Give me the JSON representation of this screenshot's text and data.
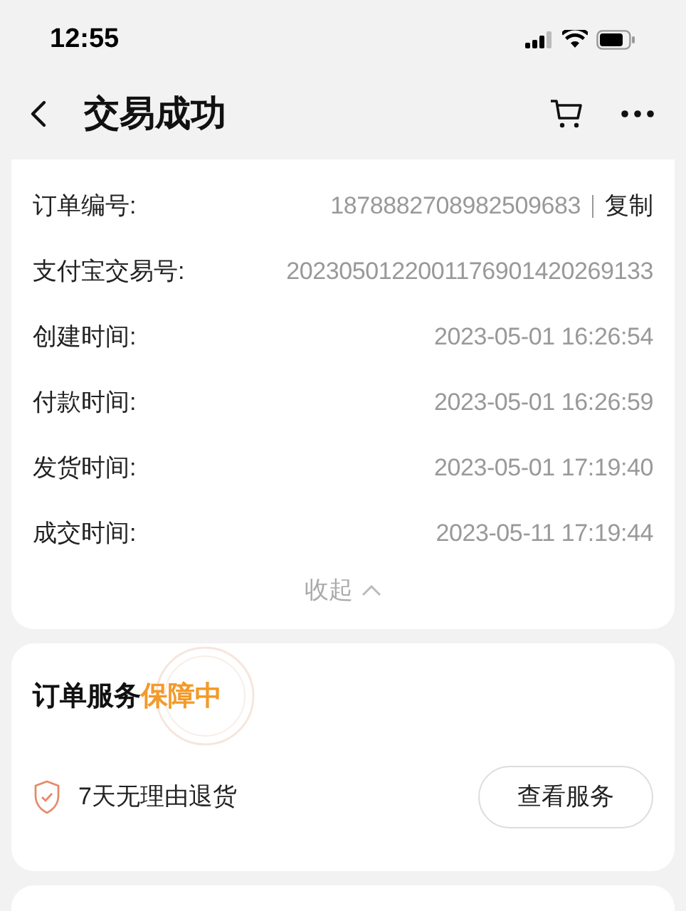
{
  "status_bar": {
    "time": "12:55"
  },
  "header": {
    "title": "交易成功"
  },
  "order_info": {
    "rows": [
      {
        "label": "订单编号:",
        "value": "1878882708982509683",
        "action": "复制"
      },
      {
        "label": "支付宝交易号:",
        "value": "2023050122001176901420269133"
      },
      {
        "label": "创建时间:",
        "value": "2023-05-01 16:26:54"
      },
      {
        "label": "付款时间:",
        "value": "2023-05-01 16:26:59"
      },
      {
        "label": "发货时间:",
        "value": "2023-05-01 17:19:40"
      },
      {
        "label": "成交时间:",
        "value": "2023-05-11 17:19:44"
      }
    ],
    "collapse": "收起"
  },
  "service": {
    "title": "订单服务",
    "status": "保障中",
    "item": "7天无理由退货",
    "button": "查看服务"
  }
}
